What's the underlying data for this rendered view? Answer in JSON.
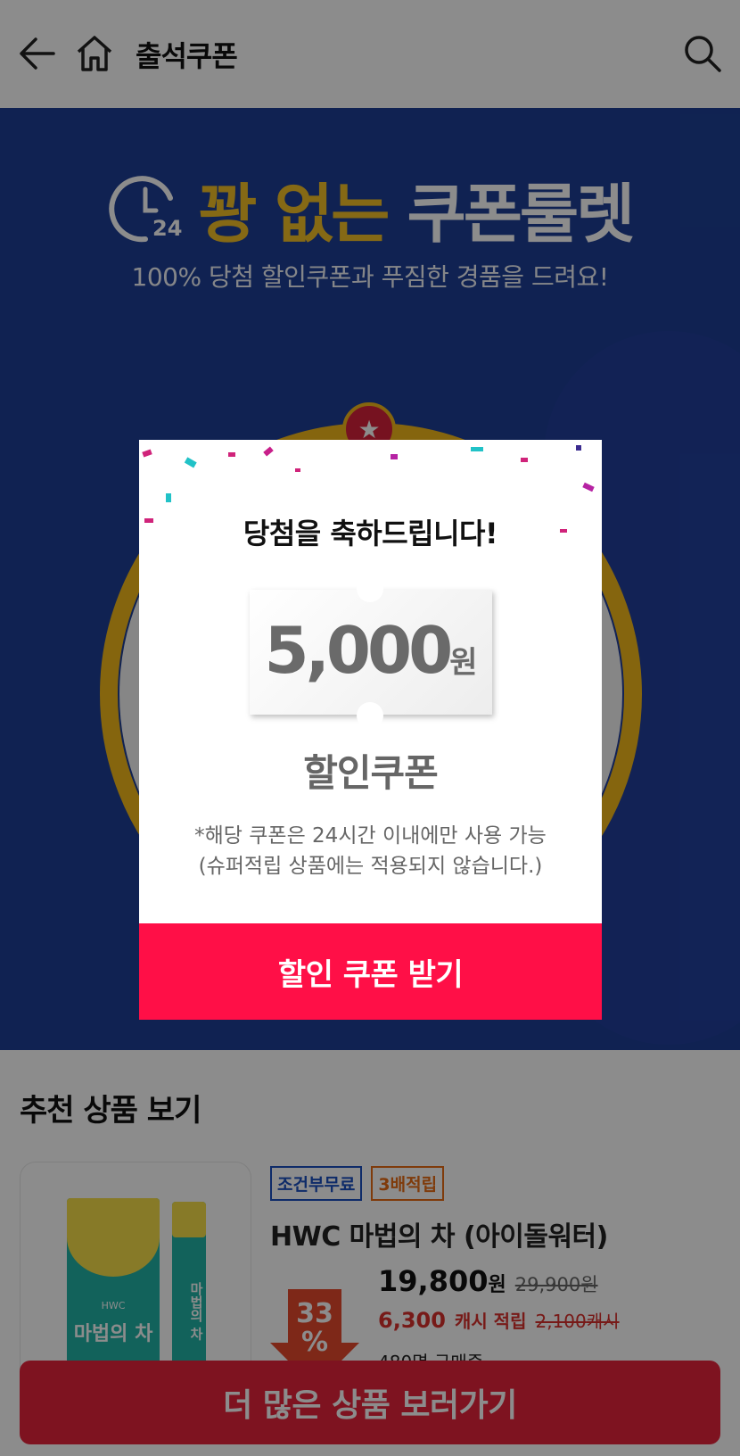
{
  "header": {
    "title": "출석쿠폰",
    "back_icon": "back-arrow-icon",
    "home_icon": "home-icon",
    "search_icon": "search-icon"
  },
  "event": {
    "title_yellow": "꽝 없는",
    "title_white": "쿠폰룰렛",
    "clock_label": "24",
    "subtitle": "100% 당첨 할인쿠폰과 푸짐한 경품을 드려요!",
    "colors": {
      "background": "#1e3f96",
      "accent": "#f2c027"
    }
  },
  "modal": {
    "title": "당첨을 축하드립니다!",
    "amount": "5,000",
    "unit": "원",
    "coupon_label": "할인쿠폰",
    "notice_line1": "*해당 쿠폰은 24시간 이내에만 사용 가능",
    "notice_line2": "(슈퍼적립 상품에는 적용되지 않습니다.)",
    "button_label": "할인 쿠폰 받기",
    "button_color": "#ff0f47"
  },
  "recommend": {
    "title": "추천 상품 보기",
    "product": {
      "image_brand": "HWC",
      "image_name": "마법의 차",
      "badges": [
        "조건부무료",
        "3배적립"
      ],
      "name": "HWC 마법의 차 (아이돌워터)",
      "discount": "33",
      "discount_unit": "%",
      "price": "19,800",
      "price_unit": "원",
      "original_price": "29,900",
      "original_unit": "원",
      "cash": "6,300",
      "cash_label": "캐시 적립",
      "cash_original": "2,100",
      "cash_original_unit": "캐시",
      "buyers": "480명 구매중"
    },
    "more_button": "더 많은 상품 보러가기"
  }
}
